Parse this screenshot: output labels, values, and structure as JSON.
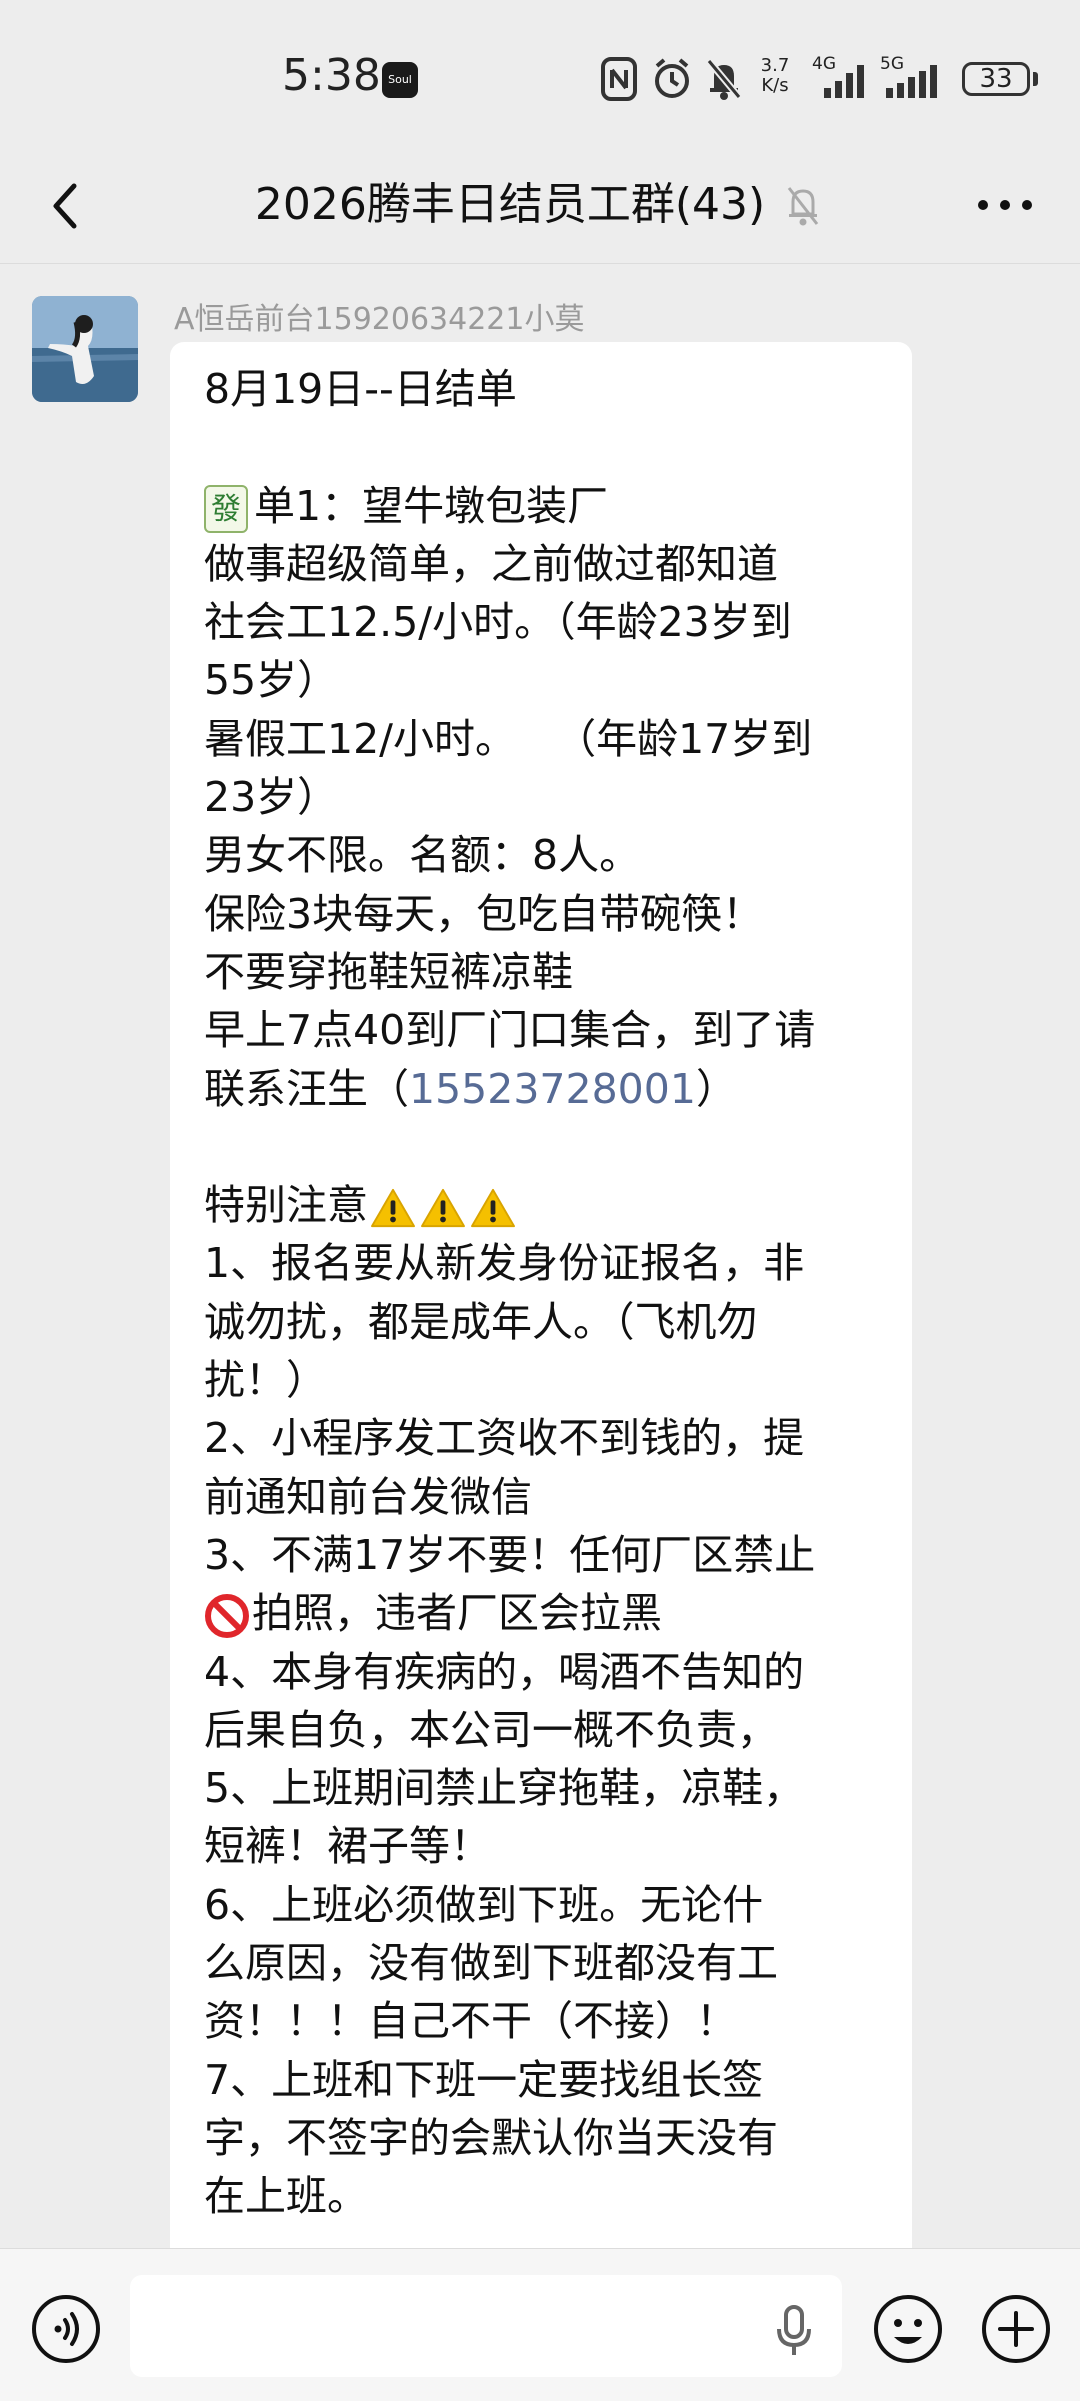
{
  "status_bar": {
    "time": "5:38",
    "soul_app_label": "Soul",
    "net_speed_value": "3.7",
    "net_speed_unit": "K/s",
    "network_1": "4G",
    "network_2": "5G",
    "battery": "33",
    "icons": [
      "nfc-icon",
      "alarm-icon",
      "silent-bell-icon",
      "signal-icon",
      "battery-icon"
    ]
  },
  "header": {
    "title": "2026腾丰日结员工群(43)",
    "icons": [
      "back-arrow-icon",
      "mute-bell-icon",
      "more-icon"
    ]
  },
  "message": {
    "sender": "A恒岳前台15920634221小莫",
    "lines": {
      "l1": "8月19日--日结单",
      "l2": "单1：望牛墩包装厂",
      "l3": "做事超级简单，之前做过都知道",
      "l4": "社会工12.5/小时。（年龄23岁到",
      "l5": "55岁）",
      "l6": "暑假工12/小时。   （年龄17岁到",
      "l7": "23岁）",
      "l8": "男女不限。名额：8人。",
      "l9": "保险3块每天，包吃自带碗筷！",
      "l10": "不要穿拖鞋短裤凉鞋",
      "l11": "早上7点40到厂门口集合，到了请",
      "l12_pre": "联系汪生（",
      "l12_phone": "15523728001",
      "l12_post": "）",
      "l13": "特别注意",
      "l14": "1、报名要从新发身份证报名，非",
      "l15": "诚勿扰，都是成年人。（飞机勿",
      "l16": "扰！）",
      "l17": "2、小程序发工资收不到钱的，提",
      "l18": "前通知前台发微信",
      "l19": "3、不满17岁不要！任何厂区禁止",
      "l20": "拍照，违者厂区会拉黑",
      "l21": "4、本身有疾病的，喝酒不告知的",
      "l22": "后果自负，本公司一概不负责，",
      "l23": "5、上班期间禁止穿拖鞋，凉鞋，",
      "l24": "短裤！裙子等！",
      "l25": "6、上班必须做到下班。无论什",
      "l26": "么原因，没有做到下班都没有工",
      "l27": "资！！！自己不干（不接）！",
      "l28": "7、上班和下班一定要找组长签",
      "l29": "字，不签字的会默认你当天没有",
      "l30": "在上班。"
    },
    "emoji": {
      "fa_tile": "發",
      "warning": [
        "warning-icon",
        "warning-icon",
        "warning-icon"
      ],
      "no_entry": "no-entry-icon"
    }
  },
  "input_bar": {
    "icons": [
      "voice-icon",
      "mic-icon",
      "emoji-icon",
      "plus-icon"
    ]
  },
  "colors": {
    "background": "#ededed",
    "bubble": "#ffffff",
    "link": "#576b95",
    "sender": "#9a9a9a"
  }
}
